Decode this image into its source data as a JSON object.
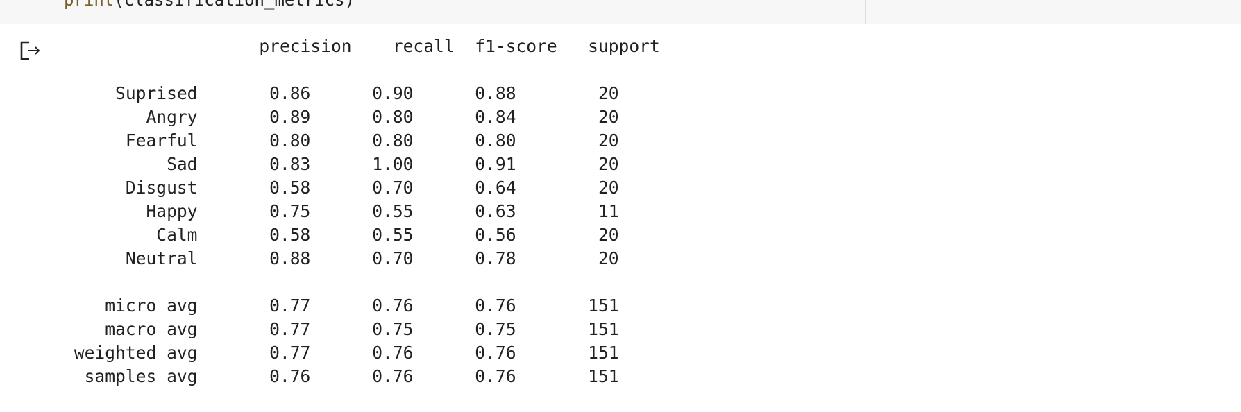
{
  "code_cell": {
    "fn": "print",
    "args": "(classification_metrics)"
  },
  "output": {
    "icon": "output-redirect-icon",
    "report_text": "                   precision    recall  f1-score   support\n\n     Suprised       0.86      0.90      0.88        20\n        Angry       0.89      0.80      0.84        20\n      Fearful       0.80      0.80      0.80        20\n          Sad       0.83      1.00      0.91        20\n      Disgust       0.58      0.70      0.64        20\n        Happy       0.75      0.55      0.63        11\n         Calm       0.58      0.55      0.56        20\n      Neutral       0.88      0.70      0.78        20\n\n    micro avg       0.77      0.76      0.76       151\n    macro avg       0.77      0.75      0.75       151\n weighted avg       0.77      0.76      0.76       151\n  samples avg       0.76      0.76      0.76       151"
  }
}
